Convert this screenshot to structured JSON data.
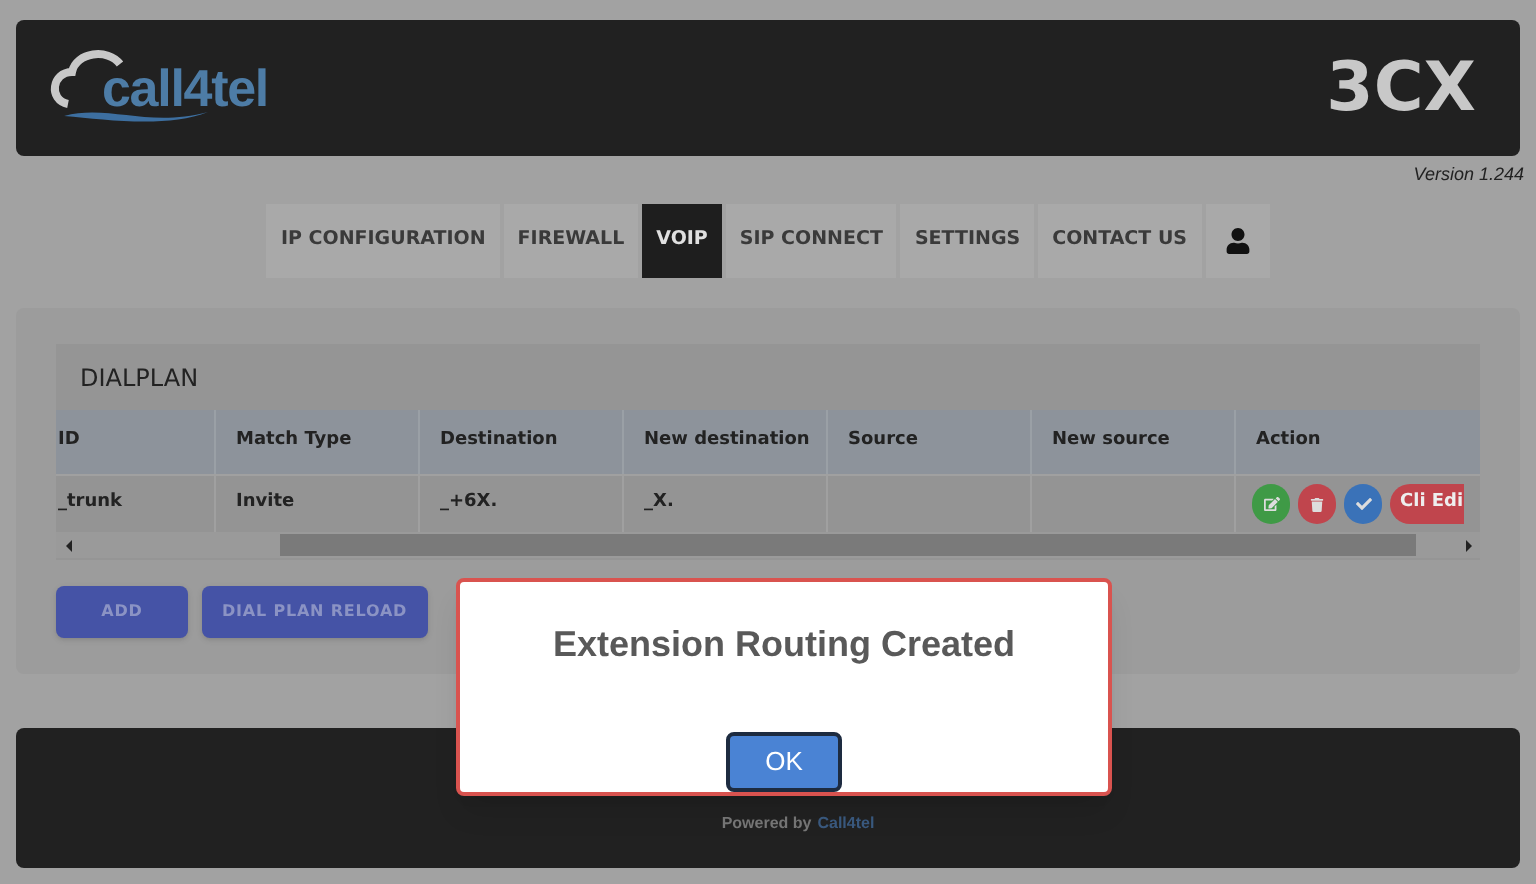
{
  "header": {
    "logo_text": "call4tel",
    "brand_text": "3CX"
  },
  "version": "Version 1.244",
  "tabs": [
    {
      "label": "IP CONFIGURATION",
      "selected": false,
      "kind": "text"
    },
    {
      "label": "FIREWALL",
      "selected": false,
      "kind": "text"
    },
    {
      "label": "VOIP",
      "selected": true,
      "kind": "text"
    },
    {
      "label": "SIP CONNECT",
      "selected": false,
      "kind": "text"
    },
    {
      "label": "SETTINGS",
      "selected": false,
      "kind": "text"
    },
    {
      "label": "CONTACT US",
      "selected": false,
      "kind": "text"
    },
    {
      "selected": false,
      "kind": "user"
    }
  ],
  "dialplan": {
    "title": "DIALPLAN",
    "columns": [
      "ID",
      "Match Type",
      "Destination",
      "New destination",
      "Source",
      "New source",
      "Action"
    ],
    "rows": [
      {
        "cells": [
          "_trunk",
          "Invite",
          "_+6X.",
          "_X.",
          "",
          ""
        ],
        "actions": [
          {
            "kind": "edit",
            "color": "#3f9a46"
          },
          {
            "kind": "delete",
            "color": "#c0454d"
          },
          {
            "kind": "check",
            "color": "#3a72b8"
          },
          {
            "kind": "label",
            "label": "Cli Edi",
            "color": "#c0454d"
          }
        ]
      }
    ]
  },
  "buttons": [
    "ADD",
    "DIAL PLAN RELOAD"
  ],
  "footer": {
    "text": "Powered by",
    "link": "Call4tel"
  },
  "dialog": {
    "message": "Extension Routing Created",
    "button": "OK"
  }
}
